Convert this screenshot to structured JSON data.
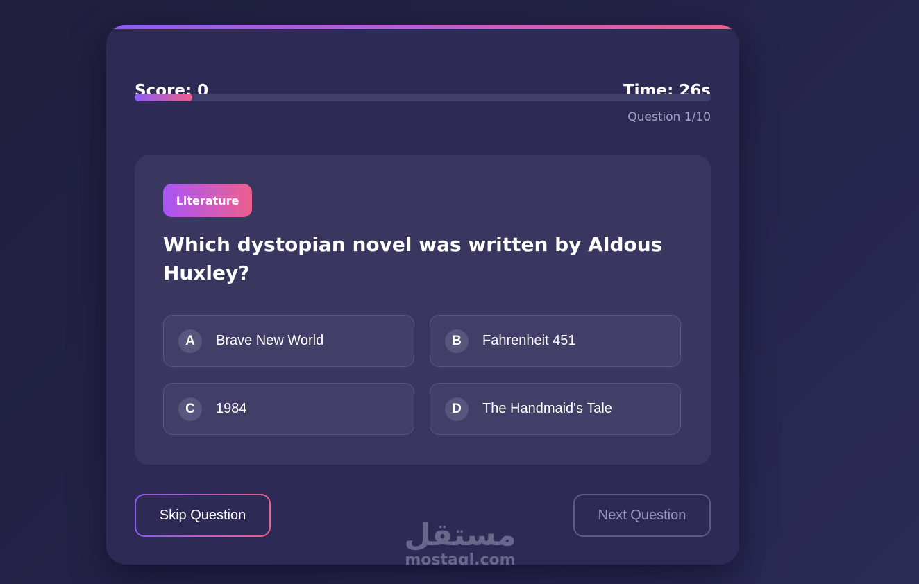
{
  "header": {
    "score_text": "Score: 0",
    "timer_text": "Time: 26s",
    "progress_fraction": 0.1,
    "question_counter": "Question 1/10"
  },
  "question": {
    "category": "Literature",
    "text": "Which dystopian novel was written by Aldous Huxley?",
    "answers": [
      {
        "letter": "A",
        "label": "Brave New World"
      },
      {
        "letter": "B",
        "label": "Fahrenheit 451"
      },
      {
        "letter": "C",
        "label": "1984"
      },
      {
        "letter": "D",
        "label": "The Handmaid's Tale"
      }
    ]
  },
  "footer": {
    "skip_label": "Skip Question",
    "next_label": "Next Question"
  },
  "watermark": {
    "arabic": "مستقل",
    "latin": "mostaql.com"
  },
  "colors": {
    "accent_start": "#8b5cf6",
    "accent_end": "#ec5f8d",
    "card_bg": "#2d2b56",
    "panel_bg": "#39375f"
  }
}
